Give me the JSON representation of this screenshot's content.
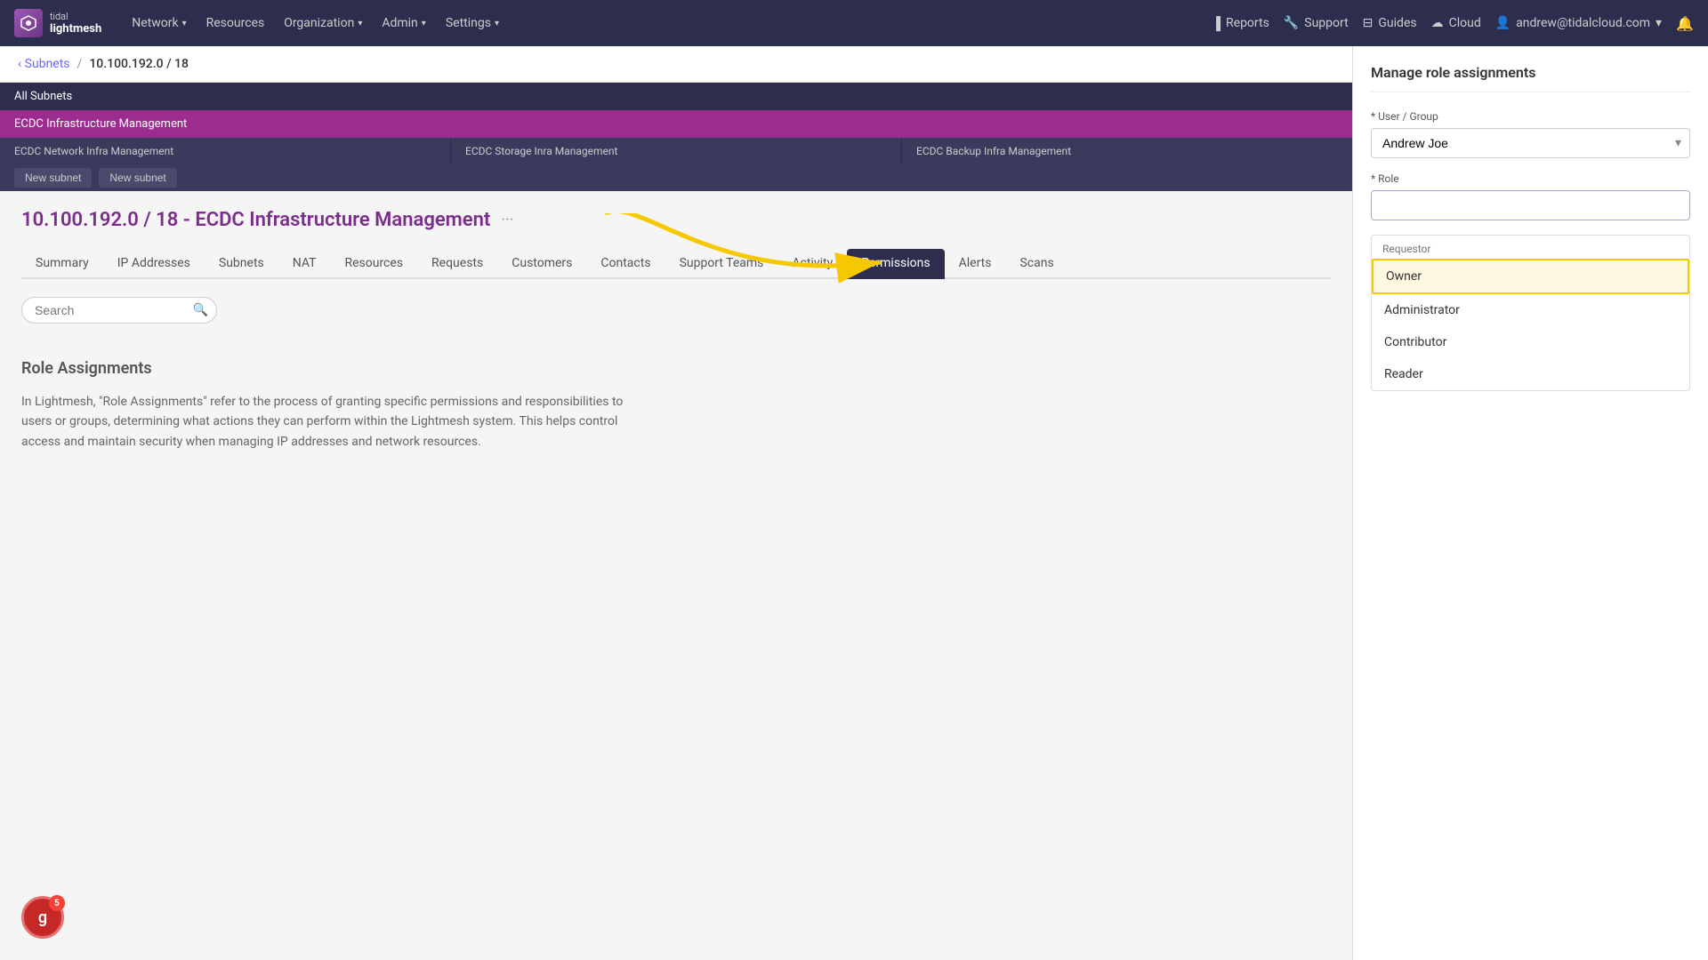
{
  "app": {
    "logo_line1": "tidal",
    "logo_line2": "lightmesh"
  },
  "navbar": {
    "links": [
      {
        "label": "Network",
        "has_dropdown": true
      },
      {
        "label": "Resources",
        "has_dropdown": false
      },
      {
        "label": "Organization",
        "has_dropdown": true
      },
      {
        "label": "Admin",
        "has_dropdown": true
      },
      {
        "label": "Settings",
        "has_dropdown": true
      }
    ],
    "right_links": [
      {
        "label": "Reports",
        "icon": "chart-icon"
      },
      {
        "label": "Support",
        "icon": "wrench-icon"
      },
      {
        "label": "Guides",
        "icon": "book-icon"
      },
      {
        "label": "Cloud",
        "icon": "cloud-icon"
      },
      {
        "label": "andrew@tidalcloud.com",
        "icon": "user-icon",
        "has_dropdown": true
      }
    ],
    "bell_label": "🔔"
  },
  "breadcrumb": {
    "back_label": "‹ Subnets",
    "separator": "/",
    "current": "10.100.192.0 / 18"
  },
  "network_tree": {
    "all_label": "All Subnets",
    "selected_label": "ECDC Infrastructure Management",
    "children": [
      {
        "label": "ECDC Network Infra Management"
      },
      {
        "label": "ECDC Storage Inra Management"
      },
      {
        "label": "ECDC Backup Infra Management"
      }
    ],
    "new_buttons": [
      {
        "label": "New subnet"
      },
      {
        "label": "New subnet"
      }
    ]
  },
  "page": {
    "title": "10.100.192.0 / 18 - ECDC Infrastructure Management",
    "more_icon": "···"
  },
  "tabs": [
    {
      "label": "Summary",
      "active": false
    },
    {
      "label": "IP Addresses",
      "active": false
    },
    {
      "label": "Subnets",
      "active": false
    },
    {
      "label": "NAT",
      "active": false
    },
    {
      "label": "Resources",
      "active": false
    },
    {
      "label": "Requests",
      "active": false
    },
    {
      "label": "Customers",
      "active": false
    },
    {
      "label": "Contacts",
      "active": false
    },
    {
      "label": "Support Teams",
      "active": false
    },
    {
      "label": "Activity",
      "active": false
    },
    {
      "label": "Permissions",
      "active": true
    },
    {
      "label": "Alerts",
      "active": false
    },
    {
      "label": "Scans",
      "active": false
    }
  ],
  "search": {
    "placeholder": "Search",
    "value": ""
  },
  "role_section": {
    "title": "Role Assignments",
    "description": "In Lightmesh, \"Role Assignments\" refer to the process of granting specific permissions and responsibilities to users or groups, determining what actions they can perform within the Lightmesh system. This helps control access and maintain security when managing IP addresses and network resources."
  },
  "right_panel": {
    "title": "Manage role assignments",
    "user_group_label": "* User / Group",
    "user_group_value": "Andrew Joe",
    "role_label": "* Role",
    "role_placeholder": "",
    "dropdown_label": "Requestor",
    "dropdown_items": [
      {
        "label": "Owner",
        "selected": true
      },
      {
        "label": "Administrator",
        "selected": false
      },
      {
        "label": "Contributor",
        "selected": false
      },
      {
        "label": "Reader",
        "selected": false
      }
    ]
  },
  "avatar": {
    "letter": "g",
    "badge": "5"
  }
}
